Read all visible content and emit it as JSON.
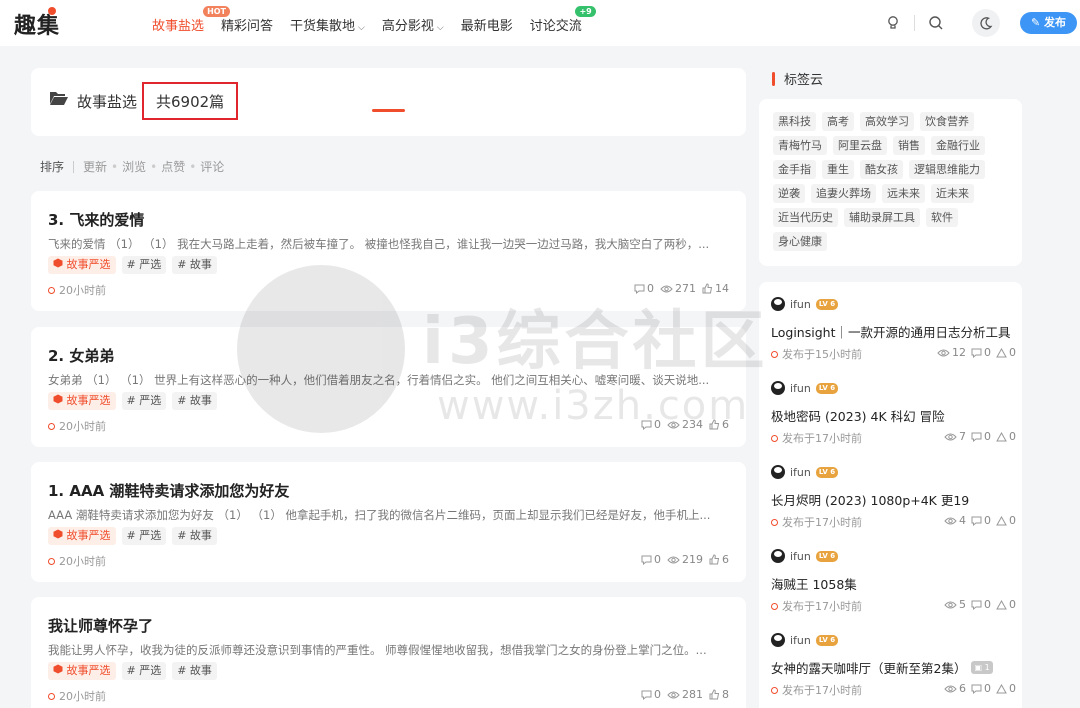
{
  "header": {
    "logo": "趣集",
    "nav": [
      {
        "label": "故事盐选",
        "active": true,
        "badge": "HOT"
      },
      {
        "label": "精彩问答"
      },
      {
        "label": "干货集散地",
        "dropdown": true
      },
      {
        "label": "高分影视",
        "dropdown": true
      },
      {
        "label": "最新电影"
      },
      {
        "label": "讨论交流",
        "badge": "+9"
      }
    ],
    "publish_label": "发布",
    "icons": [
      "bulb-icon",
      "search-icon",
      "moon-icon",
      "pencil-icon"
    ]
  },
  "category": {
    "name": "故事盐选",
    "separator": "·",
    "total": "共6902篇"
  },
  "sort": {
    "label": "排序",
    "options": [
      "更新",
      "浏览",
      "点赞",
      "评论"
    ]
  },
  "posts": [
    {
      "title": "3. 飞来的爱情",
      "excerpt": "飞来的爱情 （1） （1） 我在大马路上走着，然后被车撞了。 被撞也怪我自己，谁让我一边哭一边过马路，我大脑空白了两秒，...",
      "category_tag": "故事严选",
      "tags": [
        "# 严选",
        "# 故事"
      ],
      "time": "20小时前",
      "comments": "0",
      "views": "271",
      "likes": "14"
    },
    {
      "title": "2. 女弟弟",
      "excerpt": "女弟弟 （1） （1） 世界上有这样恶心的一种人，他们借着朋友之名，行着情侣之实。 他们之间互相关心、嘘寒问暖、谈天说地...",
      "category_tag": "故事严选",
      "tags": [
        "# 严选",
        "# 故事"
      ],
      "time": "20小时前",
      "comments": "0",
      "views": "234",
      "likes": "6"
    },
    {
      "title": "1. AAA 潮鞋特卖请求添加您为好友",
      "excerpt": "AAA 潮鞋特卖请求添加您为好友 （1） （1） 他拿起手机，扫了我的微信名片二维码，页面上却显示我们已经是好友，他手机上...",
      "category_tag": "故事严选",
      "tags": [
        "# 严选",
        "# 故事"
      ],
      "time": "20小时前",
      "comments": "0",
      "views": "219",
      "likes": "6"
    },
    {
      "title": "我让师尊怀孕了",
      "excerpt": "我能让男人怀孕，收我为徒的反派师尊还没意识到事情的严重性。 师尊假惺惺地收留我，想借我掌门之女的身份登上掌门之位。...",
      "category_tag": "故事严选",
      "tags": [
        "# 严选",
        "# 故事"
      ],
      "time": "20小时前",
      "comments": "0",
      "views": "281",
      "likes": "8"
    }
  ],
  "sidebar": {
    "tagcloud_title": "标签云",
    "tags": [
      "黑科技",
      "高考",
      "高效学习",
      "饮食营养",
      "青梅竹马",
      "阿里云盘",
      "销售",
      "金融行业",
      "金手指",
      "重生",
      "酷女孩",
      "逻辑思维能力",
      "逆袭",
      "追妻火葬场",
      "远未来",
      "近未来",
      "近当代历史",
      "辅助录屏工具",
      "软件",
      "身心健康"
    ],
    "new_posts": [
      {
        "user": "ifun",
        "level": "LV 6",
        "title": "Loginsight｜一款开源的通用日志分析工具",
        "time": "发布于15小时前",
        "views": "12",
        "comments": "0",
        "likes": "0"
      },
      {
        "user": "ifun",
        "level": "LV 6",
        "title": "极地密码 (2023) 4K 科幻 冒险",
        "time": "发布于17小时前",
        "views": "7",
        "comments": "0",
        "likes": "0"
      },
      {
        "user": "ifun",
        "level": "LV 6",
        "title": "长月烬明 (2023) 1080p+4K 更19",
        "time": "发布于17小时前",
        "views": "4",
        "comments": "0",
        "likes": "0"
      },
      {
        "user": "ifun",
        "level": "LV 6",
        "title": "海贼王 1058集",
        "time": "发布于17小时前",
        "views": "5",
        "comments": "0",
        "likes": "0"
      },
      {
        "user": "ifun",
        "level": "LV 6",
        "title": "女神的露天咖啡厅（更新至第2集）",
        "img_count": "1",
        "time": "发布于17小时前",
        "views": "6",
        "comments": "0",
        "likes": "0"
      }
    ]
  },
  "watermark": {
    "text": "i3综合社区",
    "url": "www.i3zh.com"
  },
  "colors": {
    "accent": "#f04d2c",
    "publish": "#3d96f5",
    "highlight_box": "#e0262c"
  }
}
